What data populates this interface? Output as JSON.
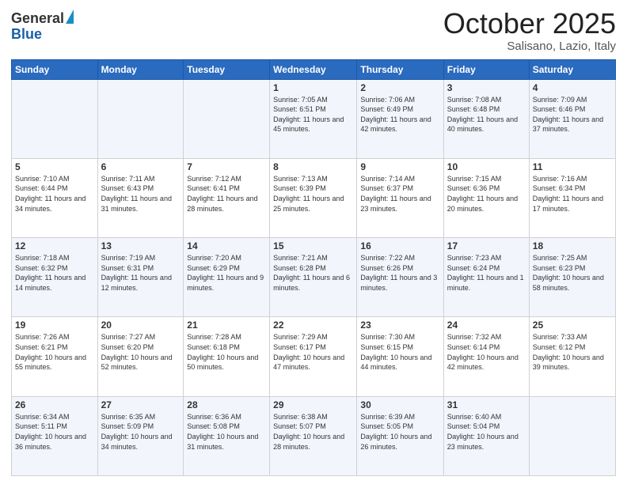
{
  "header": {
    "logo_line1": "General",
    "logo_line2": "Blue",
    "month": "October 2025",
    "location": "Salisano, Lazio, Italy"
  },
  "days_of_week": [
    "Sunday",
    "Monday",
    "Tuesday",
    "Wednesday",
    "Thursday",
    "Friday",
    "Saturday"
  ],
  "weeks": [
    [
      {
        "day": "",
        "info": ""
      },
      {
        "day": "",
        "info": ""
      },
      {
        "day": "",
        "info": ""
      },
      {
        "day": "1",
        "info": "Sunrise: 7:05 AM\nSunset: 6:51 PM\nDaylight: 11 hours\nand 45 minutes."
      },
      {
        "day": "2",
        "info": "Sunrise: 7:06 AM\nSunset: 6:49 PM\nDaylight: 11 hours\nand 42 minutes."
      },
      {
        "day": "3",
        "info": "Sunrise: 7:08 AM\nSunset: 6:48 PM\nDaylight: 11 hours\nand 40 minutes."
      },
      {
        "day": "4",
        "info": "Sunrise: 7:09 AM\nSunset: 6:46 PM\nDaylight: 11 hours\nand 37 minutes."
      }
    ],
    [
      {
        "day": "5",
        "info": "Sunrise: 7:10 AM\nSunset: 6:44 PM\nDaylight: 11 hours\nand 34 minutes."
      },
      {
        "day": "6",
        "info": "Sunrise: 7:11 AM\nSunset: 6:43 PM\nDaylight: 11 hours\nand 31 minutes."
      },
      {
        "day": "7",
        "info": "Sunrise: 7:12 AM\nSunset: 6:41 PM\nDaylight: 11 hours\nand 28 minutes."
      },
      {
        "day": "8",
        "info": "Sunrise: 7:13 AM\nSunset: 6:39 PM\nDaylight: 11 hours\nand 25 minutes."
      },
      {
        "day": "9",
        "info": "Sunrise: 7:14 AM\nSunset: 6:37 PM\nDaylight: 11 hours\nand 23 minutes."
      },
      {
        "day": "10",
        "info": "Sunrise: 7:15 AM\nSunset: 6:36 PM\nDaylight: 11 hours\nand 20 minutes."
      },
      {
        "day": "11",
        "info": "Sunrise: 7:16 AM\nSunset: 6:34 PM\nDaylight: 11 hours\nand 17 minutes."
      }
    ],
    [
      {
        "day": "12",
        "info": "Sunrise: 7:18 AM\nSunset: 6:32 PM\nDaylight: 11 hours\nand 14 minutes."
      },
      {
        "day": "13",
        "info": "Sunrise: 7:19 AM\nSunset: 6:31 PM\nDaylight: 11 hours\nand 12 minutes."
      },
      {
        "day": "14",
        "info": "Sunrise: 7:20 AM\nSunset: 6:29 PM\nDaylight: 11 hours\nand 9 minutes."
      },
      {
        "day": "15",
        "info": "Sunrise: 7:21 AM\nSunset: 6:28 PM\nDaylight: 11 hours\nand 6 minutes."
      },
      {
        "day": "16",
        "info": "Sunrise: 7:22 AM\nSunset: 6:26 PM\nDaylight: 11 hours\nand 3 minutes."
      },
      {
        "day": "17",
        "info": "Sunrise: 7:23 AM\nSunset: 6:24 PM\nDaylight: 11 hours\nand 1 minute."
      },
      {
        "day": "18",
        "info": "Sunrise: 7:25 AM\nSunset: 6:23 PM\nDaylight: 10 hours\nand 58 minutes."
      }
    ],
    [
      {
        "day": "19",
        "info": "Sunrise: 7:26 AM\nSunset: 6:21 PM\nDaylight: 10 hours\nand 55 minutes."
      },
      {
        "day": "20",
        "info": "Sunrise: 7:27 AM\nSunset: 6:20 PM\nDaylight: 10 hours\nand 52 minutes."
      },
      {
        "day": "21",
        "info": "Sunrise: 7:28 AM\nSunset: 6:18 PM\nDaylight: 10 hours\nand 50 minutes."
      },
      {
        "day": "22",
        "info": "Sunrise: 7:29 AM\nSunset: 6:17 PM\nDaylight: 10 hours\nand 47 minutes."
      },
      {
        "day": "23",
        "info": "Sunrise: 7:30 AM\nSunset: 6:15 PM\nDaylight: 10 hours\nand 44 minutes."
      },
      {
        "day": "24",
        "info": "Sunrise: 7:32 AM\nSunset: 6:14 PM\nDaylight: 10 hours\nand 42 minutes."
      },
      {
        "day": "25",
        "info": "Sunrise: 7:33 AM\nSunset: 6:12 PM\nDaylight: 10 hours\nand 39 minutes."
      }
    ],
    [
      {
        "day": "26",
        "info": "Sunrise: 6:34 AM\nSunset: 5:11 PM\nDaylight: 10 hours\nand 36 minutes."
      },
      {
        "day": "27",
        "info": "Sunrise: 6:35 AM\nSunset: 5:09 PM\nDaylight: 10 hours\nand 34 minutes."
      },
      {
        "day": "28",
        "info": "Sunrise: 6:36 AM\nSunset: 5:08 PM\nDaylight: 10 hours\nand 31 minutes."
      },
      {
        "day": "29",
        "info": "Sunrise: 6:38 AM\nSunset: 5:07 PM\nDaylight: 10 hours\nand 28 minutes."
      },
      {
        "day": "30",
        "info": "Sunrise: 6:39 AM\nSunset: 5:05 PM\nDaylight: 10 hours\nand 26 minutes."
      },
      {
        "day": "31",
        "info": "Sunrise: 6:40 AM\nSunset: 5:04 PM\nDaylight: 10 hours\nand 23 minutes."
      },
      {
        "day": "",
        "info": ""
      }
    ]
  ]
}
